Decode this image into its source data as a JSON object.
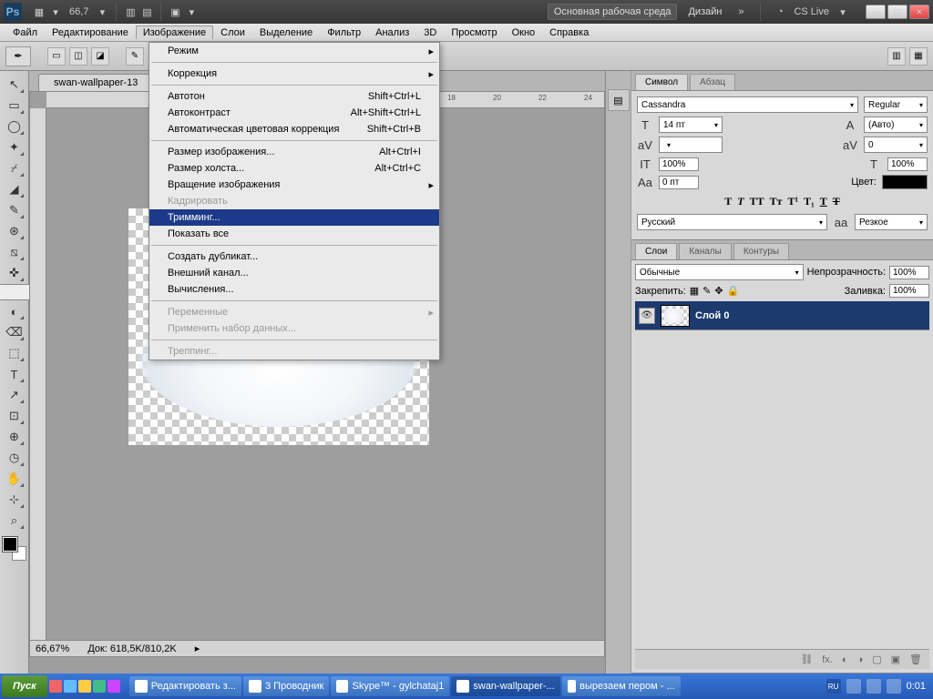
{
  "titlebar": {
    "logo": "Ps",
    "zoom": "66,7",
    "workspace_main": "Основная рабочая среда",
    "workspace_design": "Дизайн",
    "cslive": "CS Live"
  },
  "menubar": [
    "Файл",
    "Редактирование",
    "Изображение",
    "Слои",
    "Выделение",
    "Фильтр",
    "Анализ",
    "3D",
    "Просмотр",
    "Окно",
    "Справка"
  ],
  "active_menu_index": 2,
  "dropdown": {
    "groups": [
      [
        {
          "label": "Режим",
          "sub": true
        }
      ],
      [
        {
          "label": "Коррекция",
          "sub": true
        }
      ],
      [
        {
          "label": "Автотон",
          "shortcut": "Shift+Ctrl+L"
        },
        {
          "label": "Автоконтраст",
          "shortcut": "Alt+Shift+Ctrl+L"
        },
        {
          "label": "Автоматическая цветовая коррекция",
          "shortcut": "Shift+Ctrl+B"
        }
      ],
      [
        {
          "label": "Размер изображения...",
          "shortcut": "Alt+Ctrl+I"
        },
        {
          "label": "Размер холста...",
          "shortcut": "Alt+Ctrl+C"
        },
        {
          "label": "Вращение изображения",
          "sub": true
        },
        {
          "label": "Кадрировать",
          "disabled": true
        },
        {
          "label": "Тримминг...",
          "highlight": true
        },
        {
          "label": "Показать все"
        }
      ],
      [
        {
          "label": "Создать дубликат..."
        },
        {
          "label": "Внешний канал..."
        },
        {
          "label": "Вычисления..."
        }
      ],
      [
        {
          "label": "Переменные",
          "sub": true,
          "disabled": true
        },
        {
          "label": "Применить набор данных...",
          "disabled": true
        }
      ],
      [
        {
          "label": "Треппинг...",
          "disabled": true
        }
      ]
    ]
  },
  "doc_tab": "swan-wallpaper-13",
  "ruler_marks": [
    "18",
    "20",
    "22",
    "24"
  ],
  "status": {
    "zoom": "66,67%",
    "doc": "Док: 618,5K/810,2K"
  },
  "char_panel": {
    "tabs": [
      "Символ",
      "Абзац"
    ],
    "font": "Cassandra",
    "style": "Regular",
    "size": "14 пт",
    "leading": "(Авто)",
    "kerning": "",
    "tracking": "0",
    "vscale": "100%",
    "hscale": "100%",
    "baseline": "0 пт",
    "color_label": "Цвет:",
    "lang": "Русский",
    "aa": "Резкое"
  },
  "layers_panel": {
    "tabs": [
      "Слои",
      "Каналы",
      "Контуры"
    ],
    "blend": "Обычные",
    "opacity_label": "Непрозрачность:",
    "opacity": "100%",
    "lock_label": "Закрепить:",
    "fill_label": "Заливка:",
    "fill": "100%",
    "layer_name": "Слой 0"
  },
  "taskbar": {
    "start": "Пуск",
    "items": [
      {
        "label": "Редактировать з..."
      },
      {
        "label": "3 Проводник"
      },
      {
        "label": "Skype™ - gylchataj1"
      },
      {
        "label": "swan-wallpaper-...",
        "active": true
      },
      {
        "label": "вырезаем пером - ..."
      }
    ],
    "time": "0:01",
    "lang": "RU"
  },
  "tool_icons": [
    "↖",
    "▭",
    "◯",
    "✦",
    "⌿",
    "◢",
    "✎",
    "⊛",
    "⧅",
    "✜",
    "✑",
    "◐",
    "⌫",
    "⬚",
    "T",
    "↗",
    "⊡",
    "⊕",
    "◷",
    "✋",
    "⊹",
    "⌕"
  ]
}
